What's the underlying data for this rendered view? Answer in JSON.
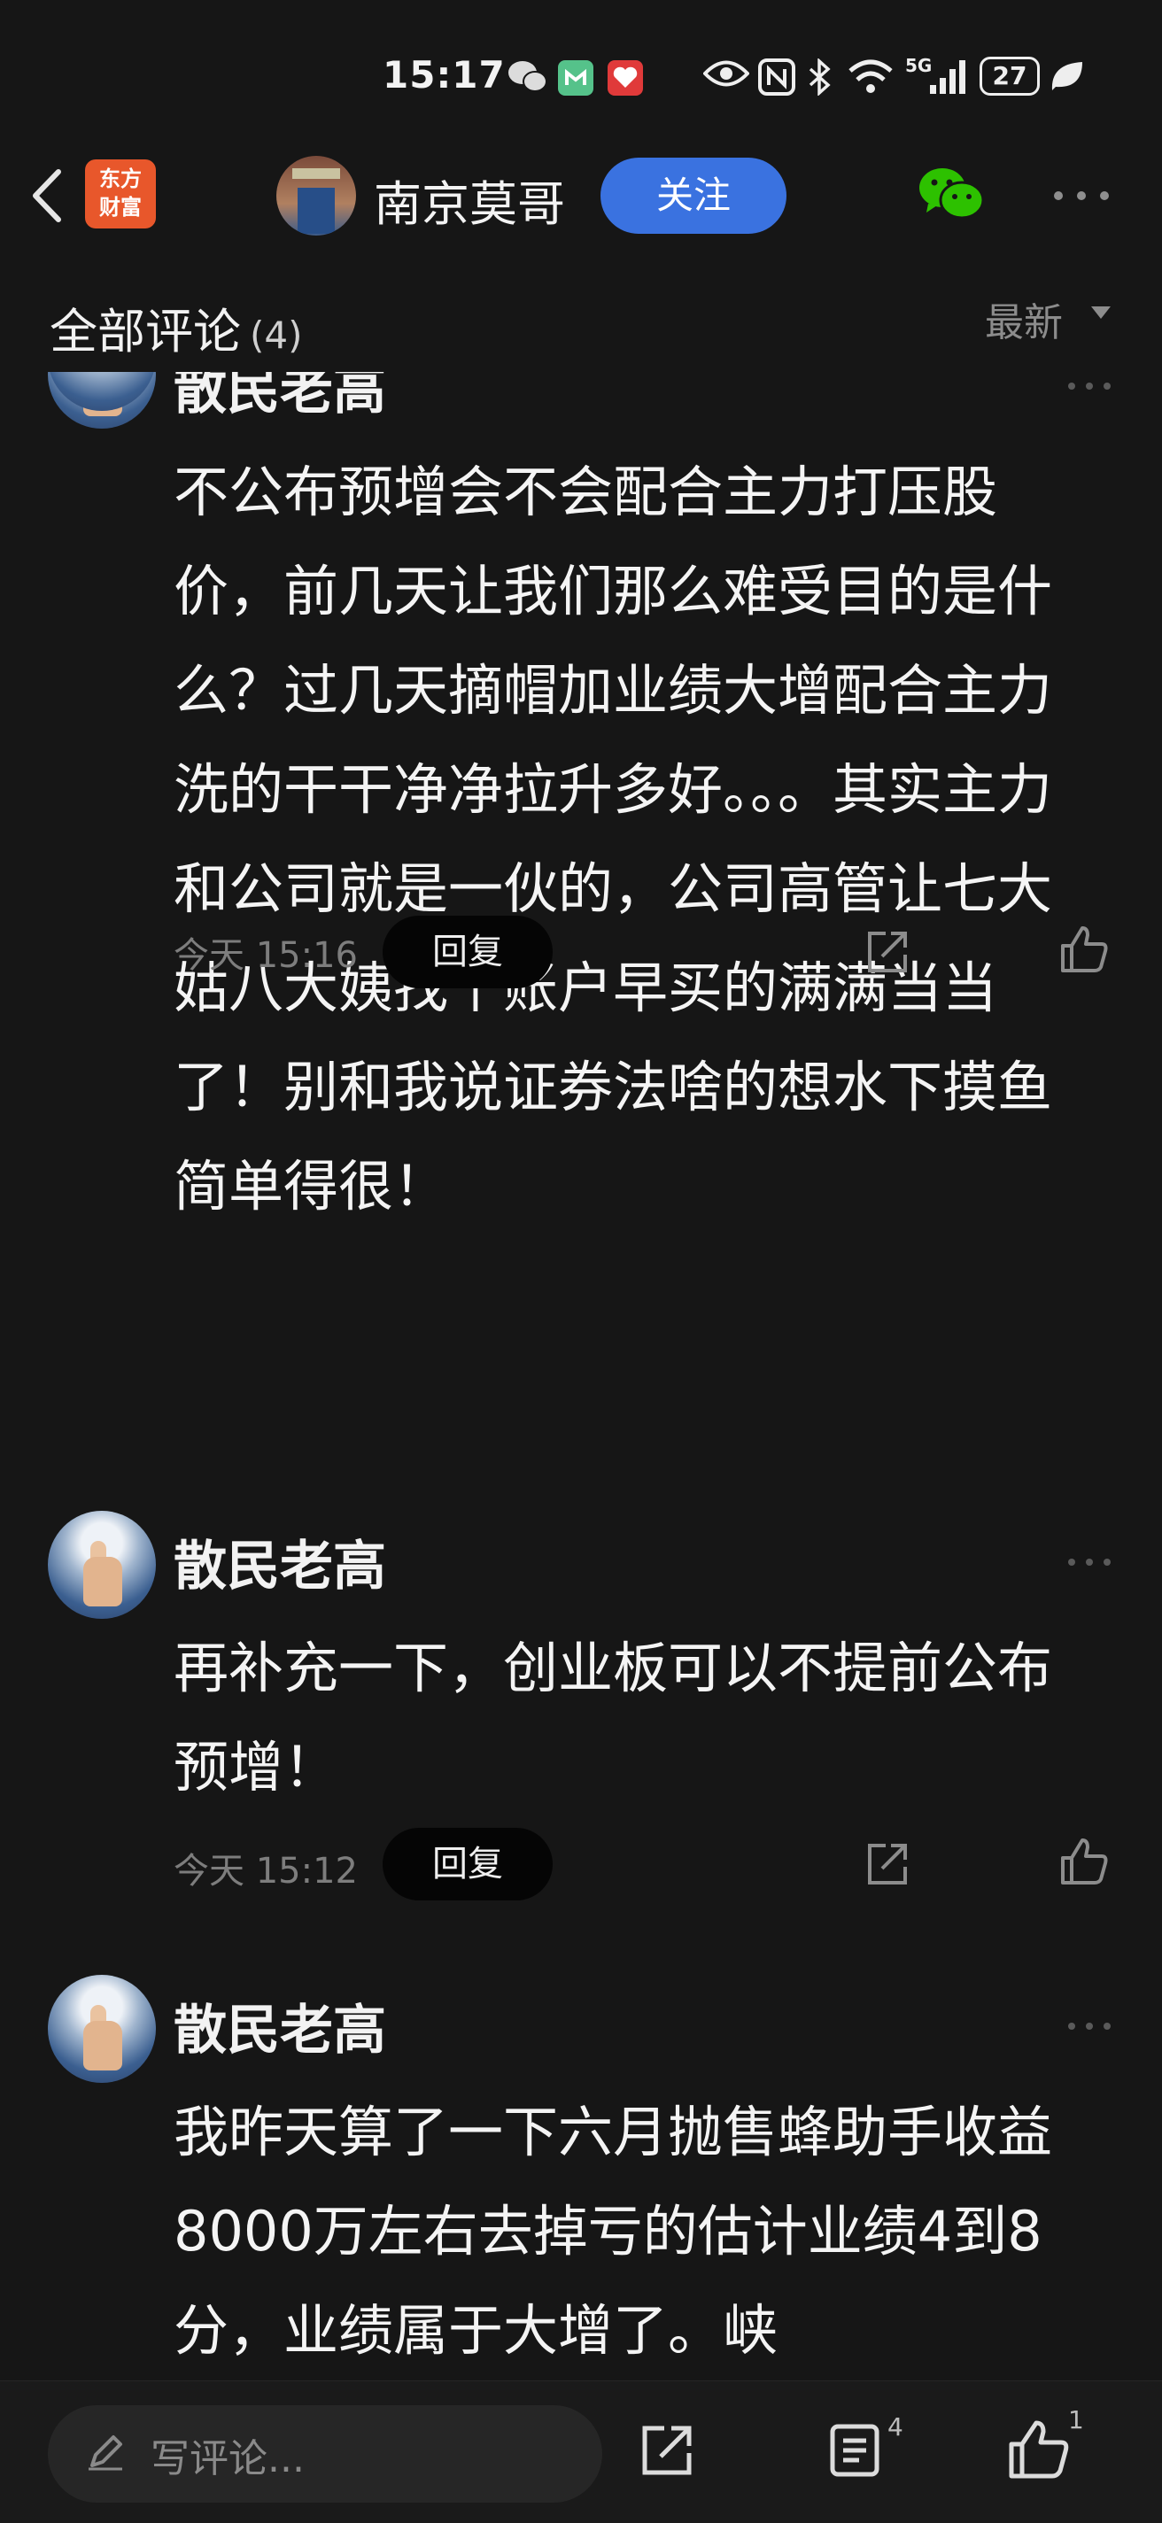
{
  "status_bar": {
    "time": "15:17",
    "network": "5G",
    "battery": "27"
  },
  "header": {
    "app_logo_line1": "东方",
    "app_logo_line2": "财富",
    "author_name": "南京莫哥",
    "follow_label": "关注"
  },
  "section": {
    "title": "全部评论",
    "count": "(4)",
    "sort_label": "最新"
  },
  "comments": [
    {
      "author": "散民老高",
      "text": "不公布预增会不会配合主力打压股价，前几天让我们那么难受目的是什么？过几天摘帽加业绩大增配合主力洗的干干净净拉升多好。。。其实主力和公司就是一伙的，公司高管让七大姑八大姨找个账户早买的满满当当了！别和我说证券法啥的想水下摸鱼简单得很！",
      "time": "今天 15:16",
      "reply_label": "回复"
    },
    {
      "author": "散民老高",
      "text": "再补充一下，创业板可以不提前公布预增！",
      "time": "今天 15:12",
      "reply_label": "回复"
    },
    {
      "author": "散民老高",
      "text": "我昨天算了一下六月抛售蜂助手收益8000万左右去掉亏的估计业绩4到8分，业绩属于大增了。峡",
      "time": "",
      "reply_label": ""
    }
  ],
  "bottom_bar": {
    "input_placeholder": "写评论...",
    "comment_count": "4",
    "like_count": "1"
  },
  "colors": {
    "background": "#161616",
    "follow_button": "#3a72e0",
    "wechat_green": "#2dc100",
    "logo_orange": "#e8572b"
  }
}
